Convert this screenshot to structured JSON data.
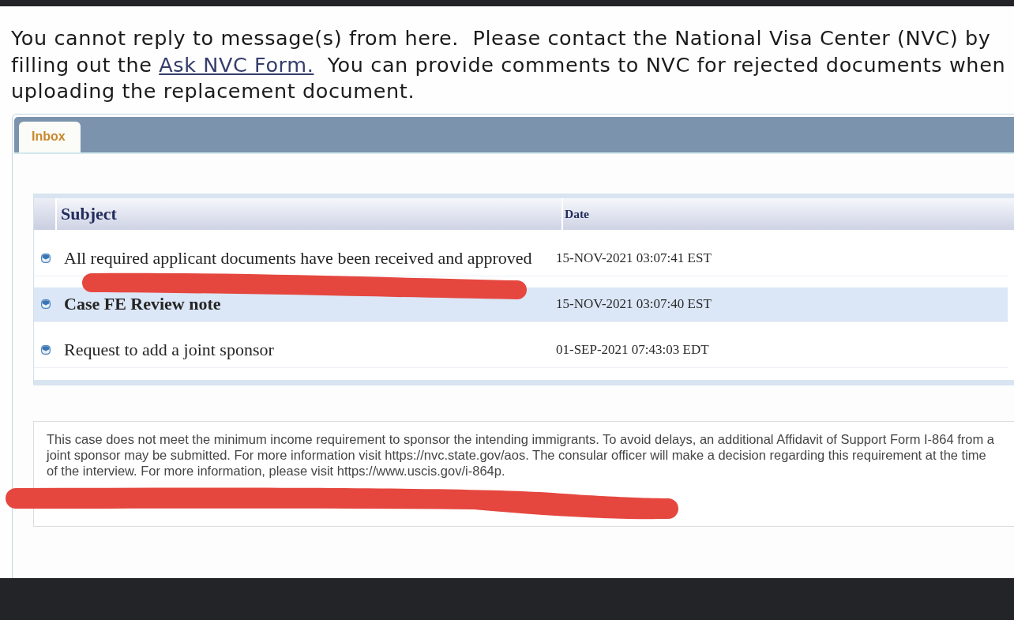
{
  "notice": {
    "text_before": "You cannot reply to message(s) from here.  Please contact the National Visa Center (NVC) by filling out the ",
    "link": "Ask NVC Form.",
    "text_after": "  You can provide comments to NVC for rejected documents when uploading the replacement document."
  },
  "tabs": [
    {
      "label": "Inbox",
      "selected": true
    }
  ],
  "messages_table": {
    "columns": [
      "Subject",
      "Date"
    ],
    "rows": [
      {
        "subject": "All required applicant documents have been received and approved",
        "date": "15-NOV-2021 03:07:41 EST",
        "selected": false,
        "unread": false
      },
      {
        "subject": "Case FE Review note",
        "date": "15-NOV-2021 03:07:40 EST",
        "selected": true,
        "unread": true
      },
      {
        "subject": "Request to add a joint sponsor",
        "date": "01-SEP-2021 07:43:03 EDT",
        "selected": false,
        "unread": false
      }
    ]
  },
  "message_body": "This case does not meet the minimum income requirement to sponsor the intending immigrants. To avoid delays, an additional Affidavit of Support Form I-864 from a joint sponsor may be submitted. For more information visit https://nvc.state.gov/aos. The consular officer will make a decision regarding this requirement at the time of the interview. For more information, please visit https://www.uscis.gov/i-864p."
}
